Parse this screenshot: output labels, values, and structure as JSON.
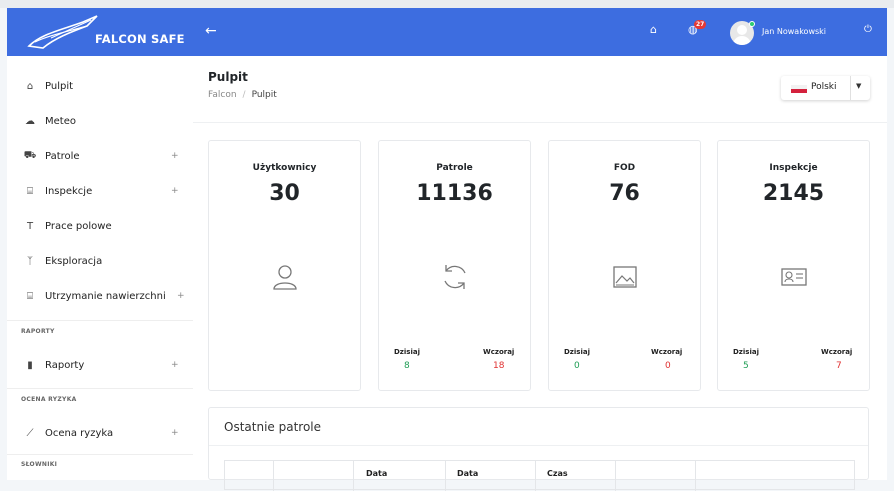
{
  "app": {
    "logo_text": "FALCON SAFE"
  },
  "topbar": {
    "back_icon": "arrow-left-icon",
    "notifications_count": "27",
    "user_name": "Jan Nowakowski"
  },
  "sidebar": {
    "items": [
      {
        "label": "Pulpit",
        "icon": "home-icon",
        "expandable": false
      },
      {
        "label": "Meteo",
        "icon": "cloud-icon",
        "expandable": false
      },
      {
        "label": "Patrole",
        "icon": "car-icon",
        "expandable": true
      },
      {
        "label": "Inspekcje",
        "icon": "building-icon",
        "expandable": true
      },
      {
        "label": "Prace polowe",
        "icon": "hammer-icon",
        "expandable": false
      },
      {
        "label": "Eksploracja",
        "icon": "antenna-icon",
        "expandable": false
      },
      {
        "label": "Utrzymanie nawierzchni",
        "icon": "building-icon",
        "expandable": true
      }
    ],
    "section_raporty": "RAPORTY",
    "raporty_item": "Raporty",
    "section_ocena": "OCENA RYZYKA",
    "ocena_item": "Ocena ryzyka",
    "section_slowniki": "SŁOWNIKI",
    "plus": "+"
  },
  "page": {
    "title": "Pulpit",
    "breadcrumb": [
      "Falcon",
      "Pulpit"
    ],
    "separator": "/"
  },
  "language": {
    "label": "Polski"
  },
  "cards": [
    {
      "title": "Użytkownicy",
      "value": "30",
      "icon": "user-icon"
    },
    {
      "title": "Patrole",
      "value": "11136",
      "icon": "refresh-icon",
      "today_label": "Dzisiaj",
      "today": "8",
      "yesterday_label": "Wczoraj",
      "yesterday": "18"
    },
    {
      "title": "FOD",
      "value": "76",
      "icon": "image-icon",
      "today_label": "Dzisiaj",
      "today": "0",
      "yesterday_label": "Wczoraj",
      "yesterday": "0"
    },
    {
      "title": "Inspekcje",
      "value": "2145",
      "icon": "id-card-icon",
      "today_label": "Dzisiaj",
      "today": "5",
      "yesterday_label": "Wczoraj",
      "yesterday": "7"
    }
  ],
  "recent": {
    "title": "Ostatnie patrole",
    "columns": [
      "Data",
      "Data",
      "Czas"
    ]
  },
  "colors": {
    "primary": "#3d6de0",
    "green": "#1f9d55",
    "red": "#e03131"
  }
}
